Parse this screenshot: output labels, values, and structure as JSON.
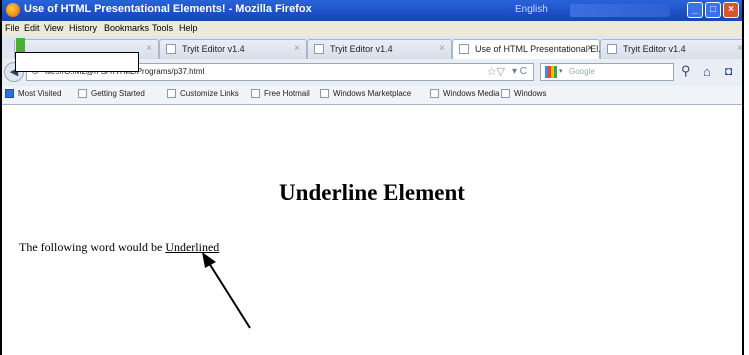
{
  "window": {
    "title": "Use of HTML Presentational Elements! - Mozilla Firefox",
    "search_hint": "English"
  },
  "menu": [
    "File",
    "Edit",
    "View",
    "History",
    "Bookmarks",
    "Tools",
    "Help"
  ],
  "tabs": [
    {
      "label": "",
      "close": "×"
    },
    {
      "label": "Tryit Editor v1.4",
      "close": "×"
    },
    {
      "label": "Tryit Editor v1.4",
      "close": "×"
    },
    {
      "label": "Use of HTML Presentational El...",
      "close": "×",
      "active": true
    },
    {
      "label": "Tryit Editor v1.4",
      "close": "×"
    }
  ],
  "nav": {
    "url": "file:///G:/M2@n Si-/HTML/Programs/p37.html",
    "search_placeholder": "Google"
  },
  "bookmarks": [
    "Most Visited",
    "Getting Started",
    "Customize Links",
    "Free Hotmail",
    "Windows Marketplace",
    "Windows Media",
    "Windows"
  ],
  "page": {
    "heading": "Underline Element",
    "text_before": "The following word would be ",
    "underlined_word": "Underlined"
  },
  "icons": {
    "back": "back-arrow-icon",
    "home": "home-icon",
    "search": "magnifier-icon"
  }
}
